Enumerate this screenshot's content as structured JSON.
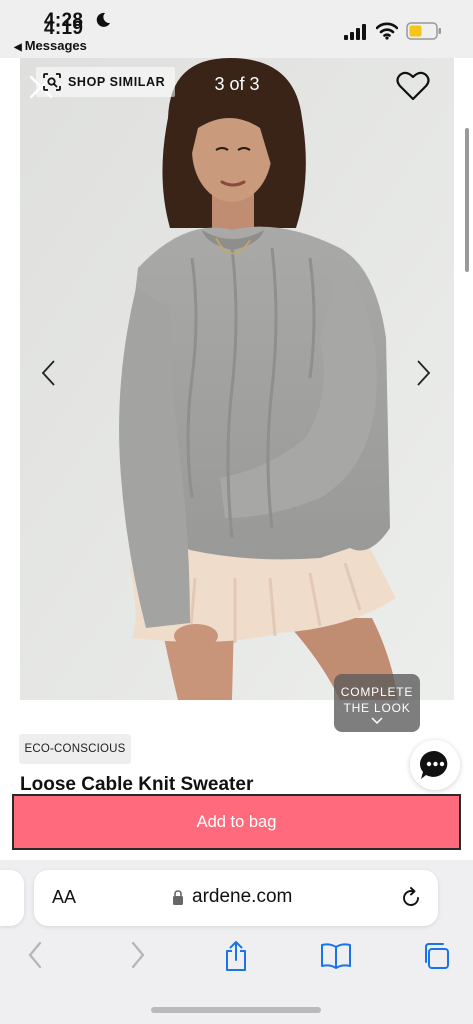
{
  "status_bar": {
    "time_behind": "4:28",
    "time_front": "4:19",
    "back_app": "Messages",
    "colors": {
      "battery": "#f5c518"
    }
  },
  "gallery": {
    "shop_similar": "SHOP SIMILAR",
    "counter": "3 of 3",
    "complete_look_line1": "COMPLETE",
    "complete_look_line2": "THE LOOK"
  },
  "product": {
    "badge": "ECO-CONSCIOUS",
    "title_partial": "Loose Cable Knit Sweater"
  },
  "actions": {
    "add_to_bag": "Add to bag",
    "colors": {
      "add_to_bag_bg": "#ff6b7c"
    }
  },
  "browser": {
    "text_size_label": "AA",
    "domain": "ardene.com",
    "icons": [
      "lock-icon",
      "reload-icon",
      "back-icon",
      "forward-icon",
      "share-icon",
      "bookmarks-icon",
      "tabs-icon"
    ]
  }
}
